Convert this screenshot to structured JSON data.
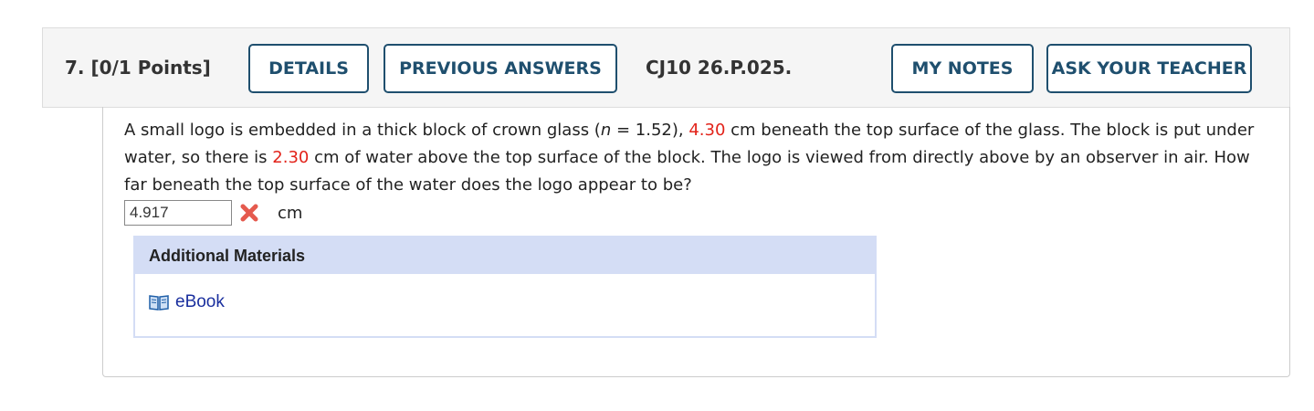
{
  "header": {
    "question_number": "7.",
    "points": "[0/1 Points]",
    "details_label": "DETAILS",
    "previous_answers_label": "PREVIOUS ANSWERS",
    "problem_code": "CJ10 26.P.025.",
    "my_notes_label": "MY NOTES",
    "ask_teacher_label": "ASK YOUR TEACHER"
  },
  "question": {
    "part1": "A small logo is embedded in a thick block of crown glass (",
    "n_symbol": "n",
    "part2": " = 1.52), ",
    "depth_value": "4.30",
    "part3": " cm beneath the top surface of the glass. The block is put under water, so there is ",
    "water_value": "2.30",
    "part4": " cm of water above the top surface of the block. The logo is viewed from directly above by an observer in air. How far beneath the top surface of the water does the logo appear to be?"
  },
  "answer": {
    "value": "4.917",
    "status": "incorrect",
    "unit": "cm"
  },
  "additional_materials": {
    "title": "Additional Materials",
    "ebook_label": "eBook"
  },
  "colors": {
    "button_border": "#1f4f6e",
    "highlight_red": "#e2231a",
    "materials_header_bg": "#d4ddf5",
    "link_blue": "#1a2f9e"
  },
  "icons": {
    "incorrect": "x-mark-icon",
    "ebook": "book-icon"
  }
}
